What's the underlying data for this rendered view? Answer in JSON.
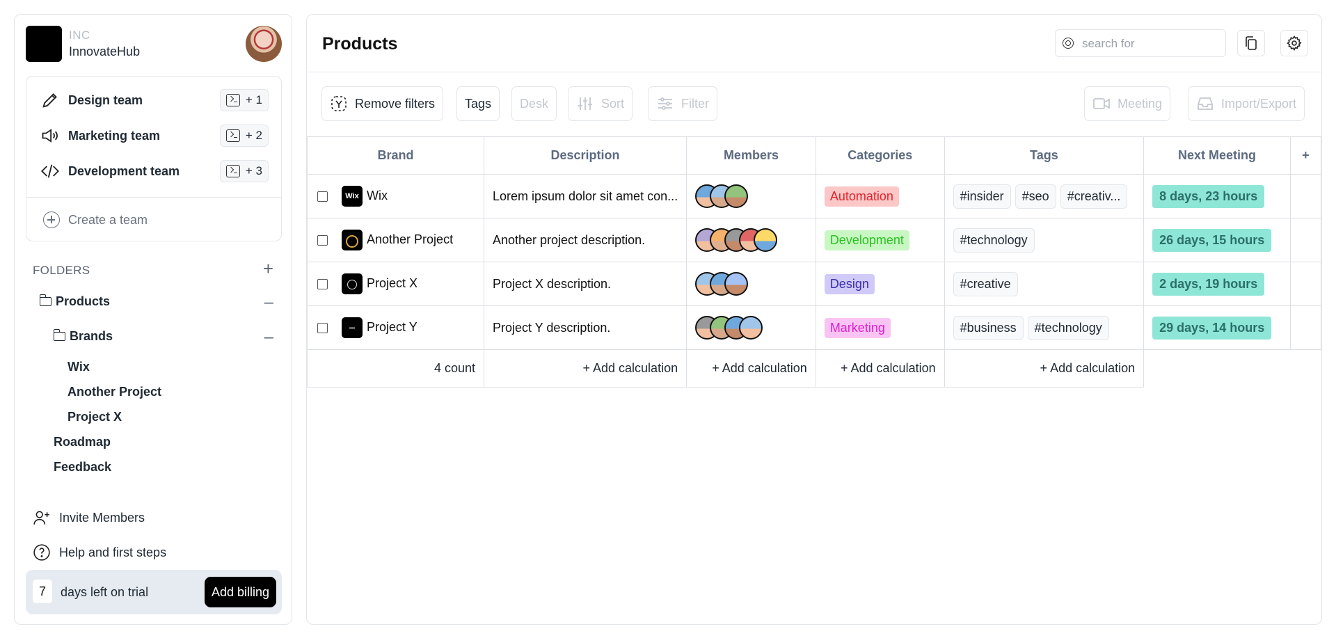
{
  "brand": {
    "org_label": "INC",
    "name": "InnovateHub"
  },
  "teams": [
    {
      "label": "Design team",
      "badge": "+ 1",
      "icon": "pencil-icon"
    },
    {
      "label": "Marketing team",
      "badge": "+ 2",
      "icon": "megaphone-icon"
    },
    {
      "label": "Development team",
      "badge": "+ 3",
      "icon": "code-icon"
    }
  ],
  "create_team_label": "Create a team",
  "folders": {
    "heading": "FOLDERS",
    "products": "Products",
    "brands": "Brands",
    "brand_items": [
      "Wix",
      "Another Project",
      "Project X"
    ],
    "other_items": [
      "Roadmap",
      "Feedback"
    ]
  },
  "bottom": {
    "invite": "Invite Members",
    "help": "Help and first steps",
    "trial_days": "7",
    "trial_text": "days left on trial",
    "billing_button": "Add billing"
  },
  "main": {
    "title": "Products",
    "search_placeholder": "search for"
  },
  "toolbar": {
    "remove_filters": "Remove filters",
    "tags": "Tags",
    "desk": "Desk",
    "sort": "Sort",
    "filter": "Filter",
    "meeting": "Meeting",
    "import_export": "Import/Export"
  },
  "table": {
    "columns": [
      "Brand",
      "Description",
      "Members",
      "Categories",
      "Tags",
      "Next Meeting",
      "+"
    ],
    "rows": [
      {
        "brand": "Wix",
        "logo": "Wix",
        "description": "Lorem ipsum dolor sit amet con...",
        "members": 3,
        "category": "Automation",
        "category_bg": "#fbc7c7",
        "category_fg": "#e0242b",
        "tags": [
          "#insider",
          "#seo",
          "#creativ..."
        ],
        "next_meeting": "8 days, 23 hours"
      },
      {
        "brand": "Another Project",
        "logo": "",
        "description": "Another project description.",
        "members": 5,
        "category": "Development",
        "category_bg": "#c9f7c4",
        "category_fg": "#29c21e",
        "tags": [
          "#technology"
        ],
        "next_meeting": "26 days, 15 hours"
      },
      {
        "brand": "Project X",
        "logo": "",
        "description": "Project X description.",
        "members": 3,
        "category": "Design",
        "category_bg": "#cfcaf7",
        "category_fg": "#3b2bb0",
        "tags": [
          "#creative"
        ],
        "next_meeting": "2 days, 19 hours"
      },
      {
        "brand": "Project Y",
        "logo": "",
        "description": "Project Y description.",
        "members": 4,
        "category": "Marketing",
        "category_bg": "#f9c4f4",
        "category_fg": "#e01fd0",
        "tags": [
          "#business",
          "#technology"
        ],
        "next_meeting": "29 days, 14 hours"
      }
    ],
    "footer": {
      "count": "4 count",
      "add_calc": "+ Add calculation"
    }
  },
  "colors": {
    "accent": "#000000",
    "meeting_bg": "#8ee6d6",
    "header_text": "#5d6b80"
  }
}
